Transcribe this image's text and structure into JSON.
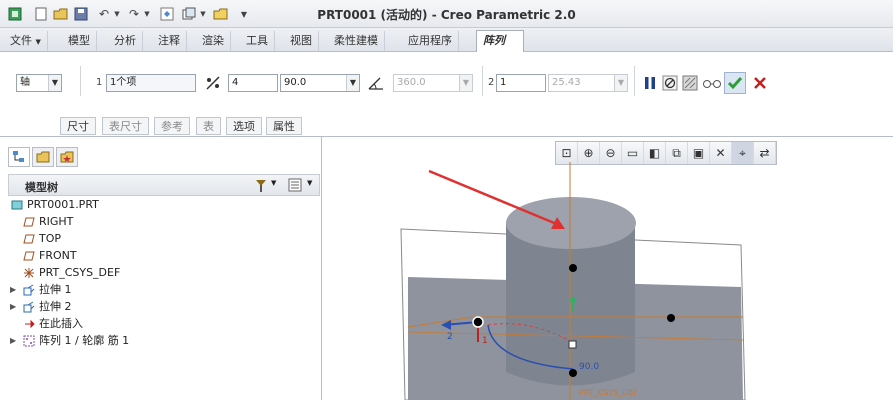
{
  "window_title": "PRT0001 (活动的) - Creo Parametric 2.0",
  "quick_access": {
    "icons": [
      "new-icon",
      "open-icon",
      "save-icon",
      "undo-icon",
      "redo-icon",
      "regenerate-icon",
      "windows-icon",
      "close-window-icon",
      "customize-icon"
    ]
  },
  "ribbon_tabs": [
    "文件",
    "模型",
    "分析",
    "注释",
    "渲染",
    "工具",
    "视图",
    "柔性建模",
    "应用程序",
    "阵列"
  ],
  "ribbon": {
    "pattern_type": "轴",
    "dir1_label": "1",
    "dir1_members": "1个项",
    "dir1_count": "4",
    "dir1_angle": "90.0",
    "dir2_count_disabled": "360.0",
    "dir2_label": "2",
    "dir2_members": "1",
    "dir2_angle_disabled": "25.43",
    "subtabs": [
      "尺寸",
      "表尺寸",
      "参考",
      "表",
      "选项",
      "属性"
    ]
  },
  "model_tree": {
    "title": "模型树",
    "items": [
      {
        "label": "PRT0001.PRT",
        "icon": "part-icon",
        "level": 0,
        "expand": ""
      },
      {
        "label": "RIGHT",
        "icon": "datum-plane-icon",
        "level": 1,
        "expand": ""
      },
      {
        "label": "TOP",
        "icon": "datum-plane-icon",
        "level": 1,
        "expand": ""
      },
      {
        "label": "FRONT",
        "icon": "datum-plane-icon",
        "level": 1,
        "expand": ""
      },
      {
        "label": "PRT_CSYS_DEF",
        "icon": "csys-icon",
        "level": 1,
        "expand": ""
      },
      {
        "label": "拉伸 1",
        "icon": "extrude-icon",
        "level": 1,
        "expand": "▶"
      },
      {
        "label": "拉伸 2",
        "icon": "extrude-icon",
        "level": 1,
        "expand": "▶"
      },
      {
        "label": "在此插入",
        "icon": "insert-here-icon",
        "level": 1,
        "expand": ""
      },
      {
        "label": "阵列 1 / 轮廓 筋 1",
        "icon": "pattern-icon",
        "level": 1,
        "expand": "▶"
      }
    ]
  },
  "viewport": {
    "dim_arrow_1": "1",
    "dim_arrow_2": "2",
    "angle_dim": "90.0",
    "csys_label": "PRT_CSYS_DEF"
  },
  "colors": {
    "accent_blue": "#2a4fb0",
    "confirm_green": "#2e9d3a",
    "cancel_red": "#c02020",
    "model_gray": "#8a8f9a"
  }
}
